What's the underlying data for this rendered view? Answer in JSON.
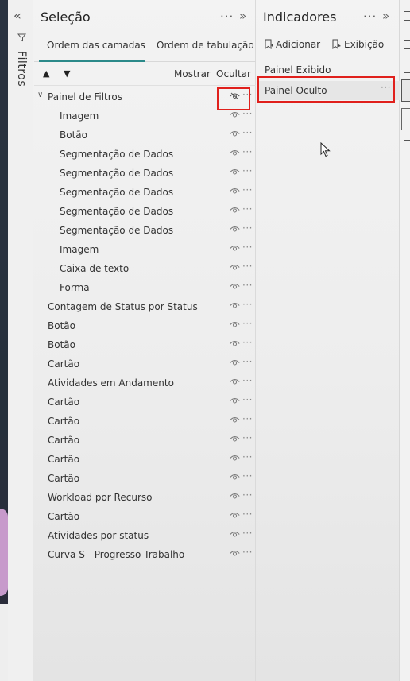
{
  "filters_pane": {
    "label": "Filtros"
  },
  "selection_pane": {
    "title": "Seleção",
    "tabs": [
      "Ordem das camadas",
      "Ordem de tabulação"
    ],
    "toolbar": {
      "show_label": "Mostrar",
      "hide_label": "Ocultar"
    },
    "layers": [
      {
        "name": "Painel de Filtros",
        "level": 0,
        "group": true,
        "hidden": true
      },
      {
        "name": "Imagem",
        "level": 1
      },
      {
        "name": "Botão",
        "level": 1
      },
      {
        "name": "Segmentação de Dados",
        "level": 1
      },
      {
        "name": "Segmentação de Dados",
        "level": 1
      },
      {
        "name": "Segmentação de Dados",
        "level": 1
      },
      {
        "name": "Segmentação de Dados",
        "level": 1
      },
      {
        "name": "Segmentação de Dados",
        "level": 1
      },
      {
        "name": "Imagem",
        "level": 1
      },
      {
        "name": "Caixa de texto",
        "level": 1
      },
      {
        "name": "Forma",
        "level": 1
      },
      {
        "name": "Contagem de Status por Status",
        "level": 0
      },
      {
        "name": "Botão",
        "level": 0
      },
      {
        "name": "Botão",
        "level": 0
      },
      {
        "name": "Cartão",
        "level": 0
      },
      {
        "name": "Atividades em Andamento",
        "level": 0
      },
      {
        "name": "Cartão",
        "level": 0
      },
      {
        "name": "Cartão",
        "level": 0
      },
      {
        "name": "Cartão",
        "level": 0
      },
      {
        "name": "Cartão",
        "level": 0
      },
      {
        "name": "Cartão",
        "level": 0
      },
      {
        "name": "Workload por Recurso",
        "level": 0
      },
      {
        "name": "Cartão",
        "level": 0
      },
      {
        "name": "Atividades por status",
        "level": 0
      },
      {
        "name": "Curva S - Progresso Trabalho",
        "level": 0
      }
    ]
  },
  "bookmarks_pane": {
    "title": "Indicadores",
    "add_label": "Adicionar",
    "view_label": "Exibição",
    "items": [
      {
        "label": "Painel Exibido",
        "active": false
      },
      {
        "label": "Painel Oculto",
        "active": true
      }
    ]
  },
  "colors": {
    "highlight": "#e0201c",
    "tab_accent": "#2b8a8a"
  }
}
